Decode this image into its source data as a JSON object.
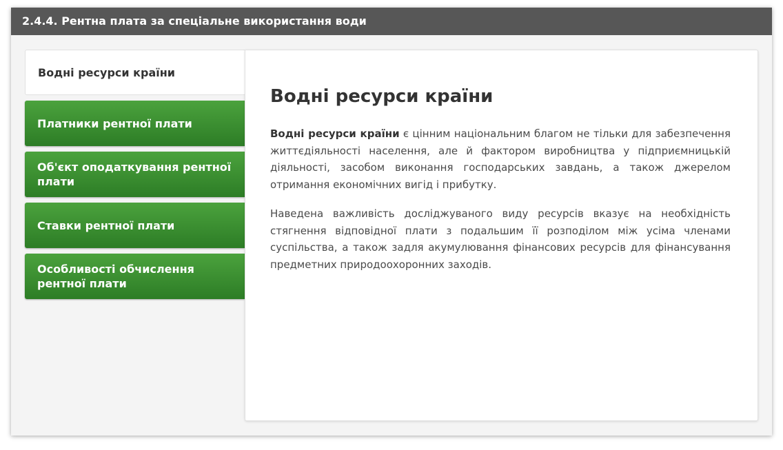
{
  "header": {
    "title": "2.4.4. Рентна плата за спеціальне використання води"
  },
  "tabs": {
    "active": "Водні ресурси країни",
    "items": [
      {
        "label": "Платники рентної плати"
      },
      {
        "label": "Об'єкт оподаткування рентної плати"
      },
      {
        "label": "Ставки рентної плати"
      },
      {
        "label": "Особливості обчислення рентної плати"
      }
    ]
  },
  "content": {
    "title": "Водні ресурси країни",
    "p1_bold": "Водні ресурси країни",
    "p1_rest": " є цінним національним благом не тільки для забезпечення життєдіяльності населення, але й фактором виробництва у підприємницькій діяльності, засобом виконання господарських завдань, а також джерелом отримання економічних вигід і прибутку.",
    "p2": "Наведена важливість досліджуваного виду ресурсів вказує на необхідність стягнення відповідної плати з подальшим її розподілом між усіма членами суспільства, а також задля акумулювання фінансових ресурсів для фінансування предметних природоохоронних заходів."
  },
  "colors": {
    "header_bg": "#575757",
    "tab_green": "#3a8f31",
    "panel_bg": "#f4f4f4"
  }
}
